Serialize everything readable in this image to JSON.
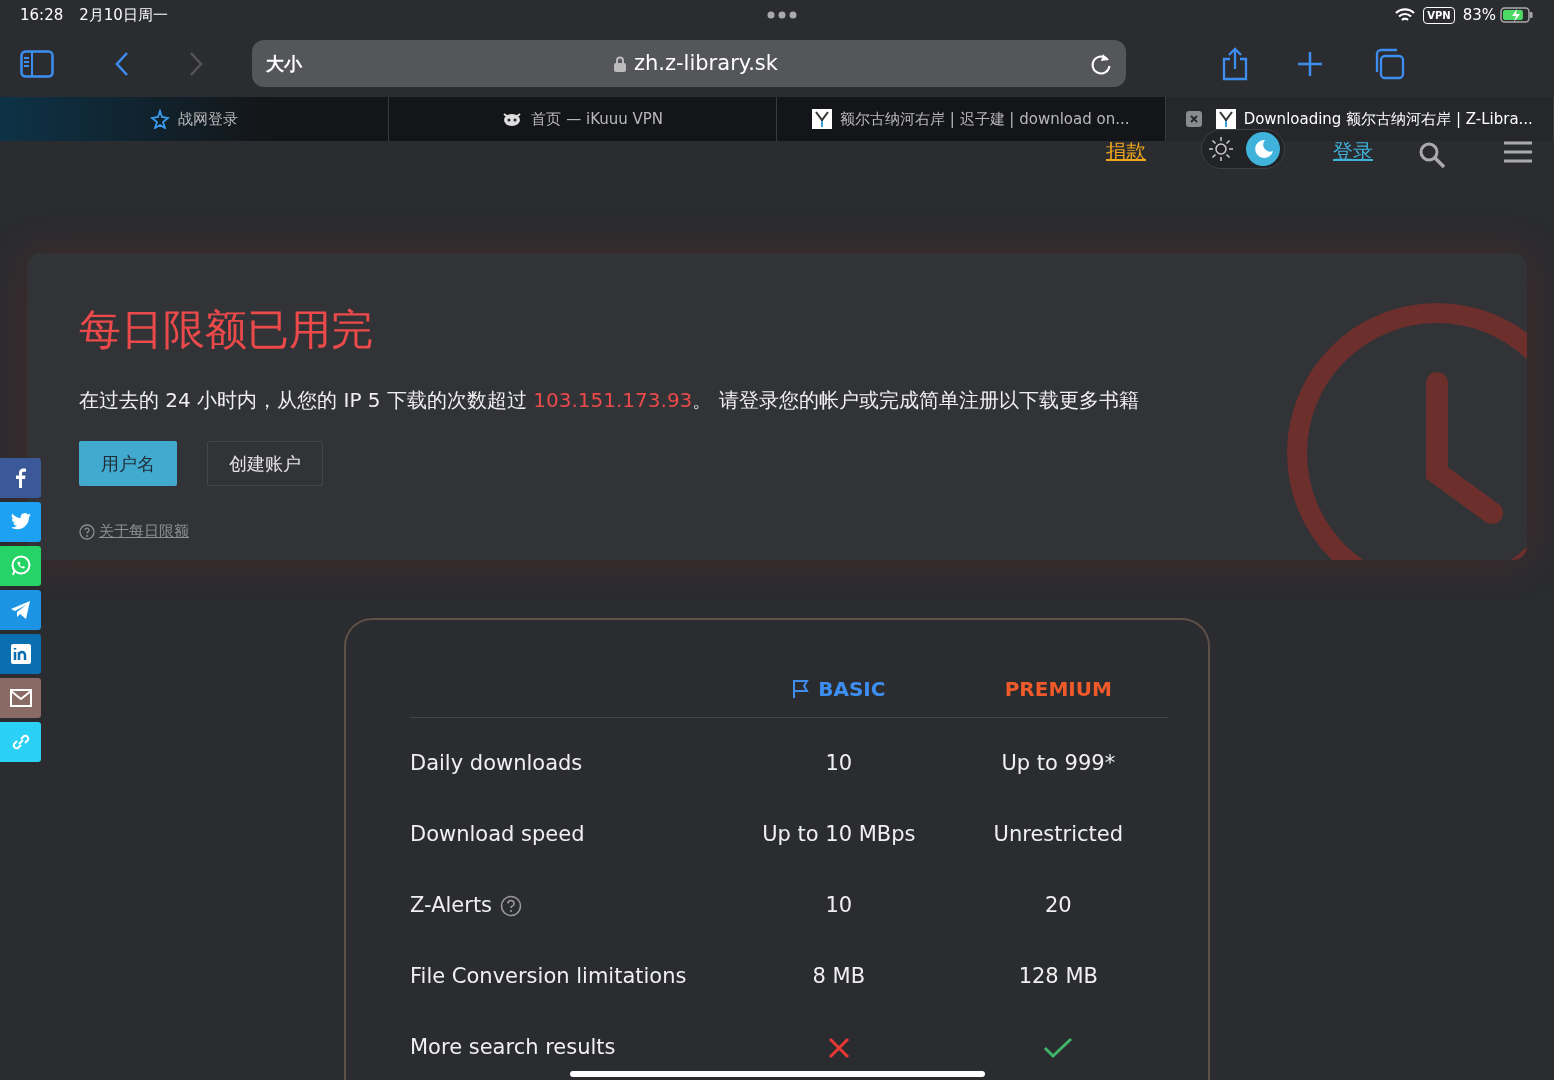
{
  "status_bar": {
    "time": "16:28",
    "date": "2月10日周一",
    "vpn": "VPN",
    "battery": "83%"
  },
  "toolbar": {
    "text_size": "大小",
    "url": "zh.z-library.sk"
  },
  "tabs": [
    {
      "label": "战网登录",
      "selected": false,
      "kind": "bnet"
    },
    {
      "label": "首页 — iKuuu VPN",
      "selected": false,
      "kind": "cat"
    },
    {
      "label": "额尔古纳河右岸 | 迟子建 | download on...",
      "selected": false,
      "kind": "zlib"
    },
    {
      "label": "Downloading 额尔古纳河右岸 | Z-Libra...",
      "selected": true,
      "kind": "zlib"
    }
  ],
  "site_nav": {
    "donate": "捐款",
    "login": "登录",
    "dark_mode": true
  },
  "alert": {
    "title": "每日限额已用完",
    "text_before": "在过去的 24 小时内，从您的 IP 5 下载的次数超过 ",
    "ip": "103.151.173.93",
    "text_after": "。 请登录您的帐户或完成简单注册以下载更多书籍",
    "buttons": [
      {
        "label": "用户名",
        "kind": "primary"
      },
      {
        "label": "创建账户",
        "kind": "outline"
      }
    ],
    "help_link": "关于每日限额"
  },
  "share": [
    {
      "kind": "facebook",
      "color": "#3b5998"
    },
    {
      "kind": "twitter",
      "color": "#1da1f2"
    },
    {
      "kind": "whatsapp",
      "color": "#25d366"
    },
    {
      "kind": "telegram",
      "color": "#1c93e3"
    },
    {
      "kind": "linkedin",
      "color": "#0a6fb0"
    },
    {
      "kind": "email",
      "color": "#8a6a64"
    },
    {
      "kind": "link",
      "color": "#2ad0f5"
    }
  ],
  "pricing": {
    "basic": "BASIC",
    "premium": "PREMIUM",
    "rows": [
      {
        "kind": "text",
        "label": "Daily downloads",
        "basic": "10",
        "premium": "Up to 999*"
      },
      {
        "kind": "text",
        "label": "Download speed",
        "basic": "Up to 10 MBps",
        "premium": "Unrestricted"
      },
      {
        "kind": "text",
        "label": "Z-Alerts",
        "help": true,
        "basic": "10",
        "premium": "20"
      },
      {
        "kind": "text",
        "label": "File Conversion limitations",
        "basic": "8 MB",
        "premium": "128 MB"
      },
      {
        "kind": "check",
        "label": "More search results",
        "basic_included": false,
        "premium_included": true
      }
    ]
  }
}
